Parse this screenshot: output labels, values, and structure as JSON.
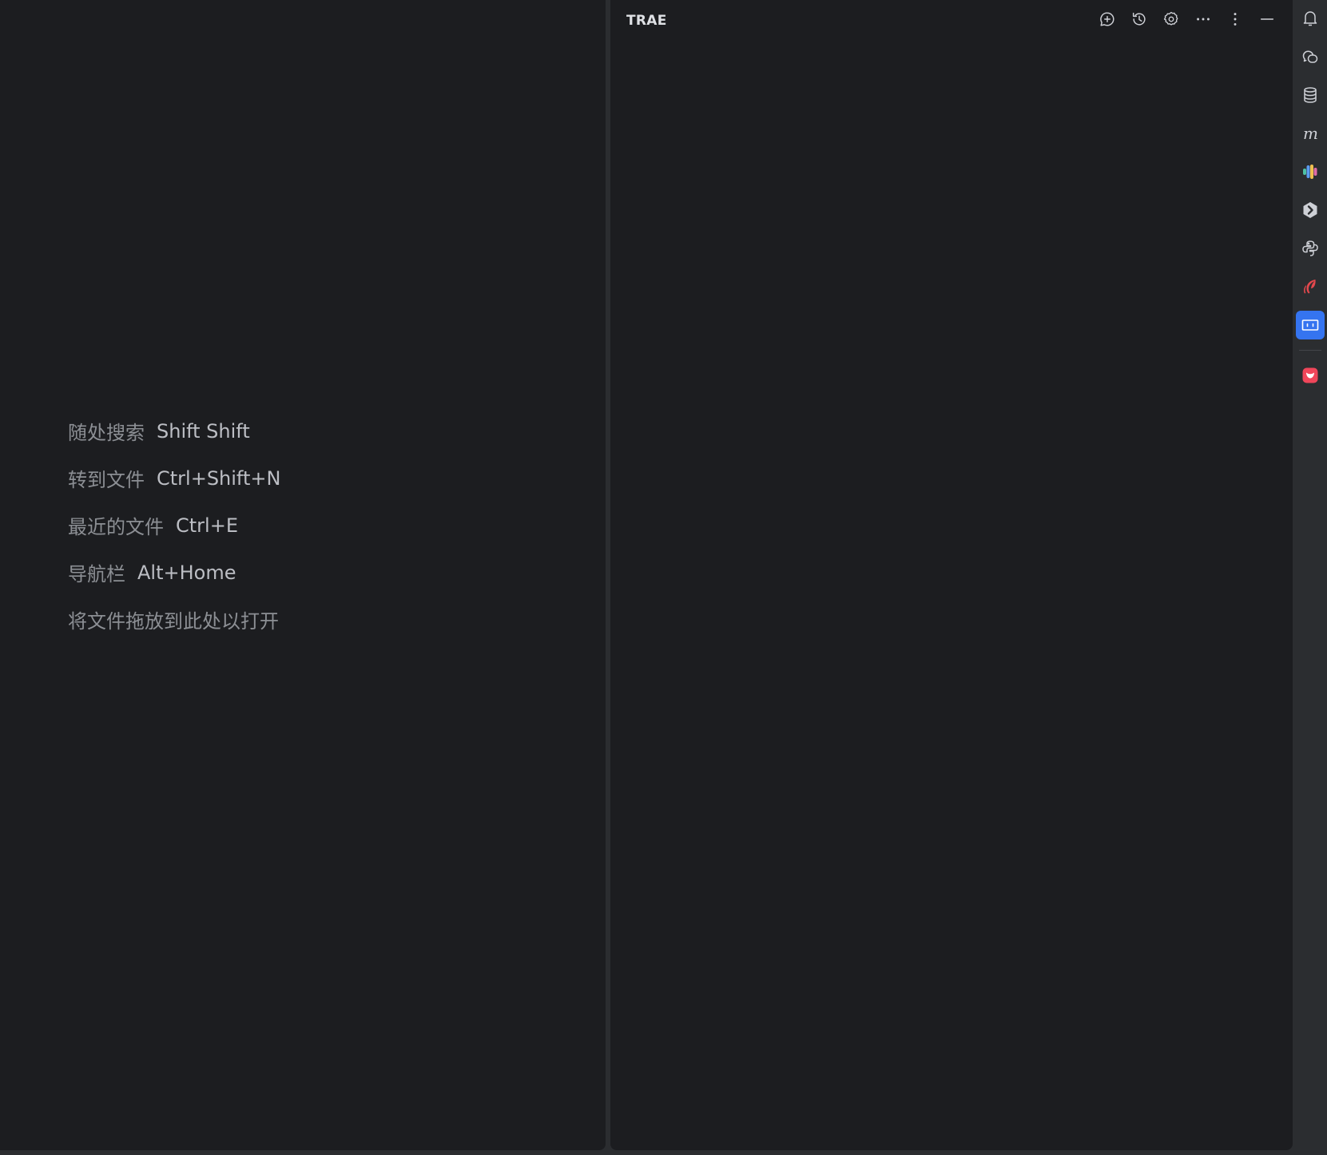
{
  "editor": {
    "hints": [
      {
        "label": "随处搜索",
        "shortcut": "Shift Shift"
      },
      {
        "label": "转到文件",
        "shortcut": "Ctrl+Shift+N"
      },
      {
        "label": "最近的文件",
        "shortcut": "Ctrl+E"
      },
      {
        "label": "导航栏",
        "shortcut": "Alt+Home"
      },
      {
        "label": "将文件拖放到此处以打开",
        "shortcut": ""
      }
    ]
  },
  "tool_window": {
    "title": "TRAE",
    "actions": [
      "new-chat-icon",
      "history-icon",
      "settings-icon",
      "more-horizontal-icon",
      "more-vertical-icon",
      "minimize-icon"
    ]
  },
  "right_toolbar": {
    "items": [
      "notifications-icon",
      "ai-chat-icon",
      "database-icon",
      "maven-icon",
      "colorful-plugin-icon",
      "hexagon-plugin-icon",
      "python-console-icon",
      "red-leaf-plugin-icon",
      "trae-panel-icon",
      "red-plugin-icon"
    ],
    "active": "trae-panel-icon"
  },
  "colors": {
    "background": "#2b2d30",
    "panel": "#1c1d20",
    "accent": "#3574f0",
    "hint_label": "#8c8f94",
    "hint_key": "#bcbec4"
  }
}
